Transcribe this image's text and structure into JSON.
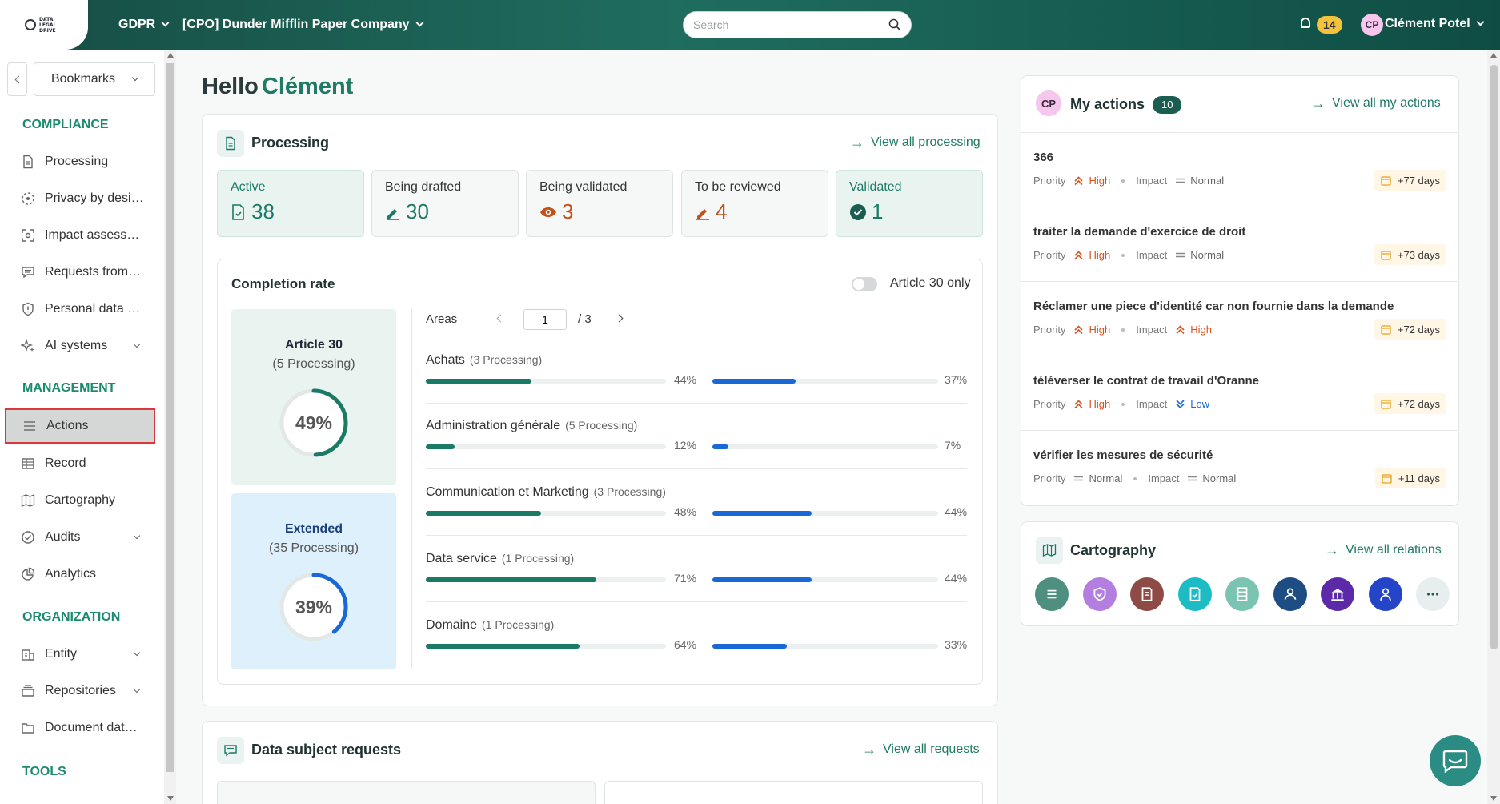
{
  "header": {
    "logo_text": "DATA LEGAL DRIVE",
    "module": "GDPR",
    "company": "[CPO] Dunder Mifflin Paper Company",
    "search_placeholder": "Search",
    "notifications": "14",
    "user_initials": "CP",
    "user_name": "Clément Potel"
  },
  "sidebar": {
    "bookmarks": "Bookmarks",
    "sections": {
      "compliance": "COMPLIANCE",
      "management": "MANAGEMENT",
      "organization": "ORGANIZATION",
      "tools": "TOOLS"
    },
    "items": {
      "processing": "Processing",
      "privacy": "Privacy by design",
      "impact": "Impact assessments",
      "requests": "Requests from data subjects",
      "breaches": "Personal data breaches",
      "ai": "AI systems",
      "actions": "Actions",
      "record": "Record",
      "cartography": "Cartography",
      "audits": "Audits",
      "analytics": "Analytics",
      "entity": "Entity",
      "repositories": "Repositories",
      "documents": "Document database"
    }
  },
  "greeting": {
    "hello": "Hello",
    "name": "Clément"
  },
  "processing": {
    "title": "Processing",
    "view_all": "View all processing",
    "statuses": [
      {
        "label": "Active",
        "value": "38",
        "color": "#1b7a66"
      },
      {
        "label": "Being drafted",
        "value": "30",
        "color": "#1b7a66"
      },
      {
        "label": "Being validated",
        "value": "3",
        "color": "#c4501a"
      },
      {
        "label": "To be reviewed",
        "value": "4",
        "color": "#c4501a"
      },
      {
        "label": "Validated",
        "value": "1",
        "color": "#1b7a66"
      }
    ]
  },
  "completion": {
    "title": "Completion rate",
    "toggle_label": "Article 30 only",
    "article30": {
      "title": "Article 30",
      "sub": "(5 Processing)",
      "percent": 49,
      "label": "49%"
    },
    "extended": {
      "title": "Extended",
      "sub": "(35 Processing)",
      "percent": 39,
      "label": "39%"
    },
    "areas_label": "Areas",
    "page": "1",
    "total_pages": "/ 3",
    "areas": [
      {
        "name": "Achats",
        "count": "(3 Processing)",
        "art30": 44,
        "art30_label": "44%",
        "ext": 37,
        "ext_label": "37%"
      },
      {
        "name": "Administration générale",
        "count": "(5 Processing)",
        "art30": 12,
        "art30_label": "12%",
        "ext": 7,
        "ext_label": "7%"
      },
      {
        "name": "Communication et Marketing",
        "count": "(3 Processing)",
        "art30": 48,
        "art30_label": "48%",
        "ext": 44,
        "ext_label": "44%"
      },
      {
        "name": "Data service",
        "count": "(1 Processing)",
        "art30": 71,
        "art30_label": "71%",
        "ext": 44,
        "ext_label": "44%"
      },
      {
        "name": "Domaine",
        "count": "(1 Processing)",
        "art30": 64,
        "art30_label": "64%",
        "ext": 33,
        "ext_label": "33%"
      }
    ]
  },
  "requests": {
    "title": "Data subject requests",
    "view_all": "View all requests"
  },
  "my_actions": {
    "initials": "CP",
    "title": "My actions",
    "count": "10",
    "view_all": "View all my actions",
    "priority_label": "Priority",
    "impact_label": "Impact",
    "items": [
      {
        "title": "366",
        "priority": "High",
        "impact": "Normal",
        "due": "+77 days"
      },
      {
        "title": "traiter la demande d'exercice de droit",
        "priority": "High",
        "impact": "Normal",
        "due": "+73 days"
      },
      {
        "title": "Réclamer une piece d'identité car non fournie dans la demande",
        "priority": "High",
        "impact": "High",
        "due": "+72 days"
      },
      {
        "title": "téléverser le contrat de travail d'Oranne",
        "priority": "High",
        "impact": "Low",
        "due": "+72 days"
      },
      {
        "title": "vérifier les mesures de sécurité",
        "priority": "Normal",
        "impact": "Normal",
        "due": "+11 days"
      }
    ]
  },
  "cartography": {
    "title": "Cartography",
    "view_all": "View all relations",
    "circles": [
      {
        "icon": "list-icon",
        "color": "#4f8f7f"
      },
      {
        "icon": "shield-icon",
        "color": "#b47ee0"
      },
      {
        "icon": "document-icon",
        "color": "#8e4a45"
      },
      {
        "icon": "checklist-icon",
        "color": "#1dbcc4"
      },
      {
        "icon": "server-icon",
        "color": "#7bc4b2"
      },
      {
        "icon": "users-icon",
        "color": "#1d4d82"
      },
      {
        "icon": "bank-icon",
        "color": "#5c2aa8"
      },
      {
        "icon": "person-icon",
        "color": "#2545c9"
      },
      {
        "icon": "more-icon",
        "color": "#e6efed"
      }
    ]
  }
}
